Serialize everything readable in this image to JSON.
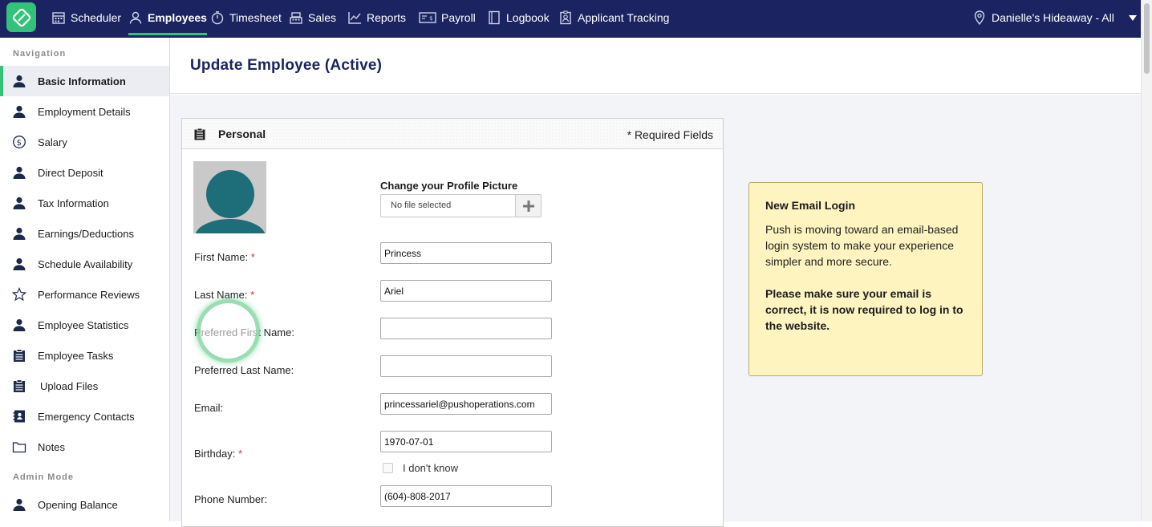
{
  "topnav": {
    "items": [
      {
        "label": "Scheduler",
        "icon": "calendar-icon"
      },
      {
        "label": "Employees",
        "icon": "user-icon"
      },
      {
        "label": "Timesheet",
        "icon": "stopwatch-icon"
      },
      {
        "label": "Sales",
        "icon": "cash-register-icon"
      },
      {
        "label": "Reports",
        "icon": "line-chart-icon"
      },
      {
        "label": "Payroll",
        "icon": "bill-icon"
      },
      {
        "label": "Logbook",
        "icon": "book-icon"
      },
      {
        "label": "Applicant Tracking",
        "icon": "badge-icon"
      }
    ],
    "active": "Employees",
    "location": "Danielle's Hideaway - All"
  },
  "sidebar": {
    "nav_heading": "Navigation",
    "items": [
      {
        "label": "Basic Information",
        "icon": "user-icon"
      },
      {
        "label": "Employment Details",
        "icon": "user-icon"
      },
      {
        "label": "Salary",
        "icon": "dollar-circle-icon"
      },
      {
        "label": "Direct Deposit",
        "icon": "user-icon"
      },
      {
        "label": "Tax Information",
        "icon": "user-icon"
      },
      {
        "label": "Earnings/Deductions",
        "icon": "user-icon"
      },
      {
        "label": "Schedule Availability",
        "icon": "user-icon"
      },
      {
        "label": "Performance Reviews",
        "icon": "star-icon"
      },
      {
        "label": "Employee Statistics",
        "icon": "user-icon"
      },
      {
        "label": "Employee Tasks",
        "icon": "clipboard-icon"
      },
      {
        "label": "Upload Files",
        "icon": "clipboard-icon"
      },
      {
        "label": "Emergency Contacts",
        "icon": "contact-book-icon"
      },
      {
        "label": "Notes",
        "icon": "folder-icon"
      }
    ],
    "active": "Basic Information",
    "admin_heading": "Admin Mode",
    "admin_items": [
      {
        "label": "Opening Balance",
        "icon": "user-icon"
      }
    ]
  },
  "page": {
    "title": "Update Employee (Active)"
  },
  "personal": {
    "title": "Personal",
    "required_note": "* Required Fields",
    "profile_picture_label": "Change your Profile Picture",
    "file_status": "No file selected",
    "fields": {
      "first_name": {
        "label": "First Name:",
        "required": "*",
        "value": "Princess"
      },
      "last_name": {
        "label": "Last Name:",
        "required": "*",
        "value": "Ariel"
      },
      "preferred_first": {
        "label": "Preferred First Name:",
        "value": ""
      },
      "preferred_last": {
        "label": "Preferred Last Name:",
        "value": ""
      },
      "email": {
        "label": "Email:",
        "value": "princessariel@pushoperations.com"
      },
      "birthday": {
        "label": "Birthday:",
        "required": "*",
        "value": "1970-07-01"
      },
      "dont_know": {
        "label": "I don't know",
        "checked": false
      },
      "phone": {
        "label": "Phone Number:",
        "value": "(604)-808-2017"
      }
    }
  },
  "notice": {
    "title": "New Email Login",
    "body": "Push is moving toward an email-based login system to make your experience simpler and more secure.",
    "emphasis": "Please make sure your email is correct, it is now required to log in to the website."
  },
  "colors": {
    "navbar": "#1b2460",
    "accent": "#33c27a",
    "notice_bg": "#fdf4bf",
    "avatar": "#1d6e78"
  }
}
